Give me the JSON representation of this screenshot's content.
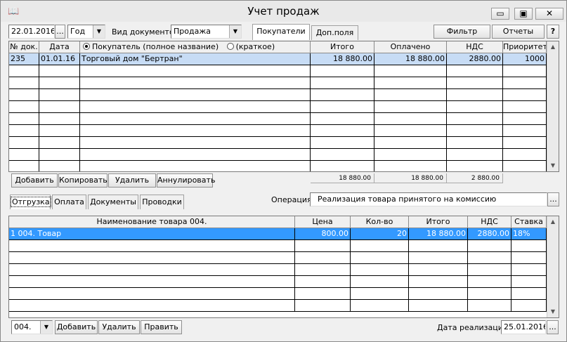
{
  "window": {
    "title": "Учет продаж",
    "minimize": "▭",
    "restore": "▣",
    "close": "✕"
  },
  "toolbar": {
    "date": "22.01.2016",
    "date_btn": "...",
    "period": "Год",
    "doc_type_label": "Вид документов",
    "doc_type": "Продажа",
    "tab_buyers": "Покупатели",
    "tab_extra": "Доп.поля",
    "filter": "Фильтр",
    "reports": "Отчеты",
    "help": "?"
  },
  "docs": {
    "headers": {
      "num": "№ док.",
      "date": "Дата",
      "buyer_full": "Покупатель (полное название)",
      "buyer_short": "(краткое)",
      "total": "Итого",
      "paid": "Оплачено",
      "vat": "НДС",
      "priority": "Приоритет"
    },
    "rows": [
      {
        "num": "235",
        "date": "01.01.16",
        "buyer": "Торговый дом \"Бертран\"",
        "total": "18 880.00",
        "paid": "18 880.00",
        "vat": "2880.00",
        "priority": "1000"
      }
    ],
    "totals": {
      "total": "18 880.00",
      "paid": "18 880.00",
      "vat": "2 880.00"
    },
    "buttons": {
      "add": "Добавить",
      "copy": "Копировать",
      "delete": "Удалить",
      "cancel": "Аннулировать"
    }
  },
  "details": {
    "tabs": [
      "Отгрузка",
      "Оплата",
      "Документы",
      "Проводки"
    ],
    "operation_label": "Операция",
    "operation": "Реализация товара принятого на комиссию",
    "operation_btn": "...",
    "headers": {
      "name": "Наименование товара 004.",
      "price": "Цена",
      "qty": "Кол-во",
      "total": "Итого",
      "vat": "НДС",
      "rate": "Ставка"
    },
    "rows": [
      {
        "name": "1 004. Товар",
        "price": "800.00",
        "qty": "20",
        "total": "18 880.00",
        "vat": "2880.00",
        "rate": "18%"
      }
    ],
    "group": "004.",
    "buttons": {
      "add": "Добавить",
      "delete": "Удалить",
      "edit": "Править"
    },
    "sale_date_label": "Дата реализации",
    "sale_date": "25.01.2016",
    "sale_date_btn": "..."
  },
  "icons": {
    "app": "book-icon",
    "dropdown": "triangle-down-icon",
    "scroll_up": "triangle-up-icon",
    "scroll_down": "triangle-down-icon"
  }
}
